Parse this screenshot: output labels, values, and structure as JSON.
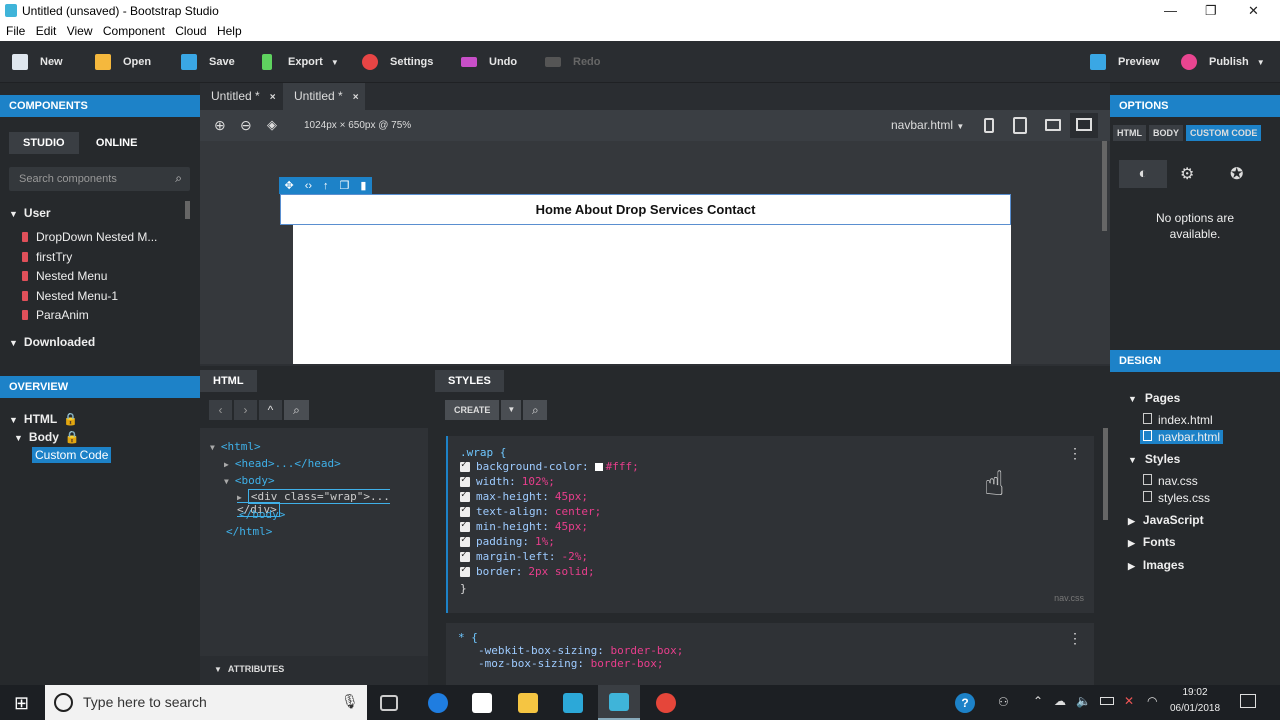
{
  "window": {
    "title": "Untitled (unsaved) - Bootstrap Studio",
    "minimize": "—",
    "restore": "❐",
    "close": "✕"
  },
  "menu": [
    "File",
    "Edit",
    "View",
    "Component",
    "Cloud",
    "Help"
  ],
  "toolbar": {
    "new": "New",
    "open": "Open",
    "save": "Save",
    "export": "Export",
    "settings": "Settings",
    "undo": "Undo",
    "redo": "Redo",
    "preview": "Preview",
    "publish": "Publish"
  },
  "components": {
    "header": "COMPONENTS",
    "tab_studio": "STUDIO",
    "tab_online": "ONLINE",
    "search_placeholder": "Search components",
    "user_category": "User",
    "items": [
      "DropDown Nested M...",
      "firstTry",
      "Nested Menu",
      "Nested Menu-1",
      "ParaAnim"
    ],
    "downloaded_category": "Downloaded"
  },
  "overview": {
    "header": "OVERVIEW",
    "html": "HTML",
    "body": "Body",
    "custom_code": "Custom Code"
  },
  "editor": {
    "tabs": [
      "Untitled *",
      "Untitled *"
    ],
    "close": "×",
    "canvas_info": "1024px × 650px @ 75%",
    "file": "navbar.html",
    "nav_text": "Home About Drop Services Contact"
  },
  "html_panel": {
    "header": "HTML",
    "lines": [
      "<html>",
      "<head>...</head>",
      "<body>",
      "<div class=\"wrap\">...</div>",
      "</body>",
      "</html>"
    ],
    "attributes": "ATTRIBUTES"
  },
  "styles_panel": {
    "header": "STYLES",
    "create": "CREATE",
    "rule1_selector": ".wrap {",
    "rule1": [
      [
        "background-color:",
        "#fff;"
      ],
      [
        "width:",
        "102%;"
      ],
      [
        "max-height:",
        "45px;"
      ],
      [
        "text-align:",
        "center;"
      ],
      [
        "min-height:",
        "45px;"
      ],
      [
        "padding:",
        "1%;"
      ],
      [
        "margin-left:",
        "-2%;"
      ],
      [
        "border:",
        "2px solid;"
      ]
    ],
    "rule1_close": "}",
    "rule1_file": "nav.css",
    "rule2_selector": "* {",
    "rule2": [
      [
        "-webkit-box-sizing:",
        "border-box;"
      ],
      [
        "-moz-box-sizing:",
        "border-box;"
      ]
    ]
  },
  "options": {
    "header": "OPTIONS",
    "tabs": [
      "HTML",
      "BODY",
      "CUSTOM CODE"
    ],
    "message": "No options are available."
  },
  "design": {
    "header": "DESIGN",
    "pages": "Pages",
    "page_files": [
      "index.html",
      "navbar.html"
    ],
    "styles": "Styles",
    "style_files": [
      "nav.css",
      "styles.css"
    ],
    "javascript": "JavaScript",
    "fonts": "Fonts",
    "images": "Images"
  },
  "taskbar": {
    "search": "Type here to search",
    "time": "19:02",
    "date": "06/01/2018"
  },
  "colors": {
    "accent": "#1d82c8",
    "panel": "#26292c",
    "toolbar": "#2a2d31"
  }
}
